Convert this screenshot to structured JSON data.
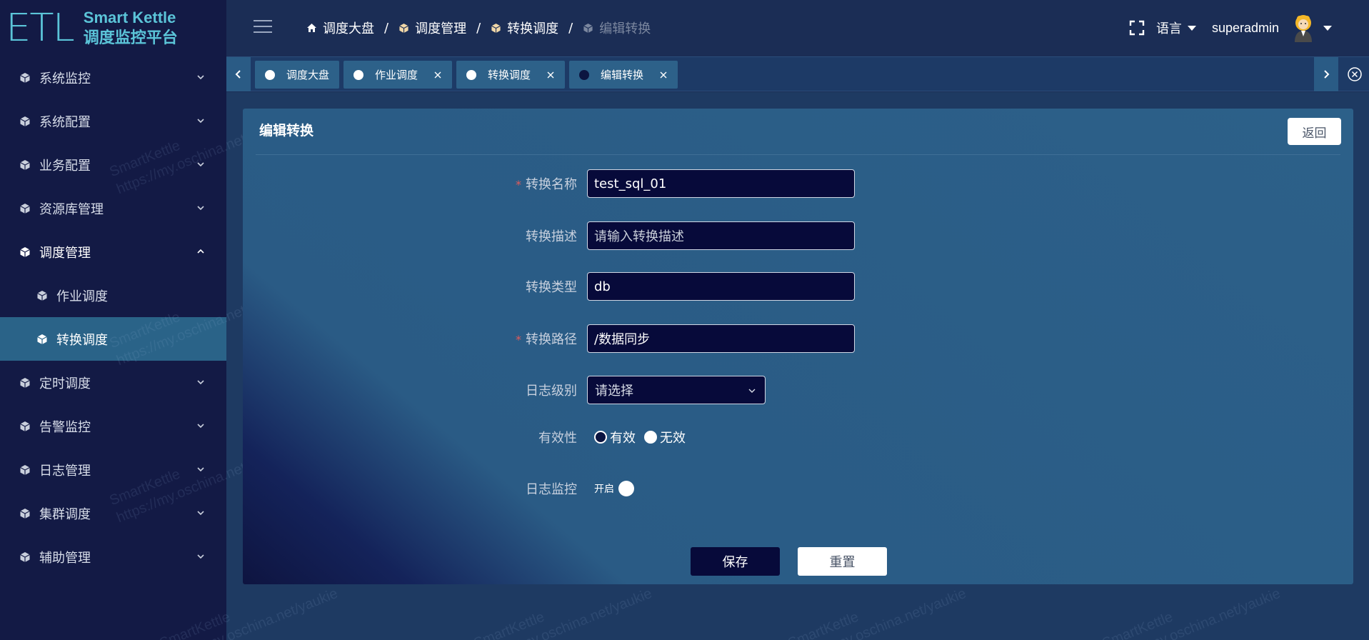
{
  "app": {
    "logo_mark": "ETL",
    "logo_en": "Smart Kettle",
    "logo_cn": "调度监控平台"
  },
  "sidebar": {
    "items": [
      {
        "label": "系统监控",
        "icon": "cube-icon",
        "expanded": false
      },
      {
        "label": "系统配置",
        "icon": "cube-icon",
        "expanded": false
      },
      {
        "label": "业务配置",
        "icon": "cube-icon",
        "expanded": false
      },
      {
        "label": "资源库管理",
        "icon": "cube-icon",
        "expanded": false
      },
      {
        "label": "调度管理",
        "icon": "cube-icon",
        "expanded": true,
        "children": [
          {
            "label": "作业调度",
            "active": false
          },
          {
            "label": "转换调度",
            "active": true
          }
        ]
      },
      {
        "label": "定时调度",
        "icon": "cube-icon",
        "expanded": false
      },
      {
        "label": "告警监控",
        "icon": "cube-icon",
        "expanded": false
      },
      {
        "label": "日志管理",
        "icon": "cube-icon",
        "expanded": false
      },
      {
        "label": "集群调度",
        "icon": "cube-icon",
        "expanded": false
      },
      {
        "label": "辅助管理",
        "icon": "cube-icon",
        "expanded": false
      }
    ]
  },
  "header": {
    "breadcrumb": [
      {
        "label": "调度大盘",
        "icon": "home-icon"
      },
      {
        "label": "调度管理",
        "icon": "cube-icon"
      },
      {
        "label": "转换调度",
        "icon": "cube-icon"
      },
      {
        "label": "编辑转换",
        "icon": "cube-icon",
        "current": true
      }
    ],
    "separator": "/",
    "language": "语言",
    "username": "superadmin"
  },
  "tabs": [
    {
      "label": "调度大盘",
      "closable": false,
      "active": false
    },
    {
      "label": "作业调度",
      "closable": true,
      "active": false
    },
    {
      "label": "转换调度",
      "closable": true,
      "active": false
    },
    {
      "label": "编辑转换",
      "closable": true,
      "active": true
    }
  ],
  "form": {
    "title": "编辑转换",
    "back_label": "返回",
    "fields": {
      "name": {
        "label": "转换名称",
        "required": true,
        "value": "test_sql_01"
      },
      "desc": {
        "label": "转换描述",
        "required": false,
        "placeholder": "请输入转换描述"
      },
      "type": {
        "label": "转换类型",
        "required": false,
        "value": "db"
      },
      "path": {
        "label": "转换路径",
        "required": true,
        "value": "/数据同步"
      },
      "log_level": {
        "label": "日志级别",
        "placeholder": "请选择"
      },
      "validity": {
        "label": "有效性",
        "options": [
          "有效",
          "无效"
        ],
        "selected": "有效"
      },
      "log_monitor": {
        "label": "日志监控",
        "switch_text": "开启"
      }
    },
    "save_label": "保存",
    "reset_label": "重置"
  },
  "watermark": {
    "line1": "SmartKettle",
    "line2": "https://my.oschina.net/yaukie"
  },
  "colors": {
    "sidebar_bg": "#131a45",
    "active_item": "#2a6388",
    "accent": "#5bc4d8",
    "input_bg": "#070a3a",
    "required": "#e05a5a"
  }
}
